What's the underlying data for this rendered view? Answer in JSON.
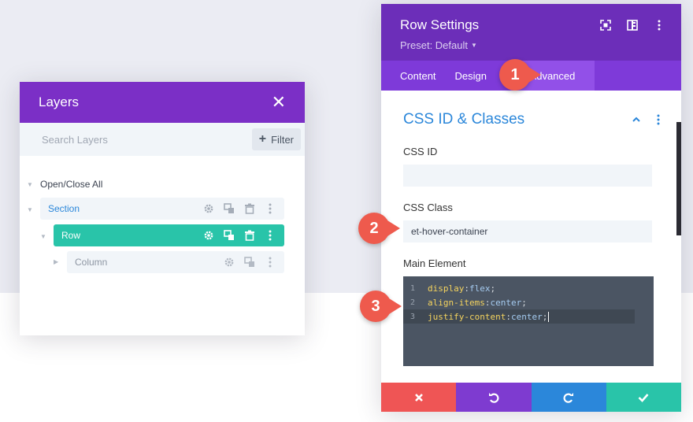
{
  "layers": {
    "title": "Layers",
    "search_placeholder": "Search Layers",
    "filter_label": "Filter",
    "open_close_label": "Open/Close All",
    "items": [
      {
        "label": "Section"
      },
      {
        "label": "Row"
      },
      {
        "label": "Column"
      }
    ]
  },
  "settings": {
    "title": "Row Settings",
    "preset": "Preset: Default",
    "tabs": {
      "content": "Content",
      "design": "Design",
      "advanced": "Advanced"
    },
    "section_title": "CSS ID & Classes",
    "css_id_label": "CSS ID",
    "css_id_value": "",
    "css_class_label": "CSS Class",
    "css_class_value": "et-hover-container",
    "main_element_label": "Main Element",
    "code_lines": [
      {
        "num": "1",
        "prop": "display",
        "val": "flex"
      },
      {
        "num": "2",
        "prop": "align-items",
        "val": "center"
      },
      {
        "num": "3",
        "prop": "justify-content",
        "val": "center"
      }
    ]
  },
  "callouts": {
    "one": "1",
    "two": "2",
    "three": "3"
  },
  "colors": {
    "layers_header": "#7b2fc6",
    "settings_header": "#6c2eb9",
    "tab_bar": "#7e3ad9",
    "tab_active": "#9250e8",
    "row_highlight": "#29c4a9",
    "section_title": "#2b87da",
    "cancel": "#ef5555",
    "undo": "#7e3bd0",
    "redo": "#2b87da",
    "save": "#29c4a9",
    "callout": "#ee5a4d"
  }
}
